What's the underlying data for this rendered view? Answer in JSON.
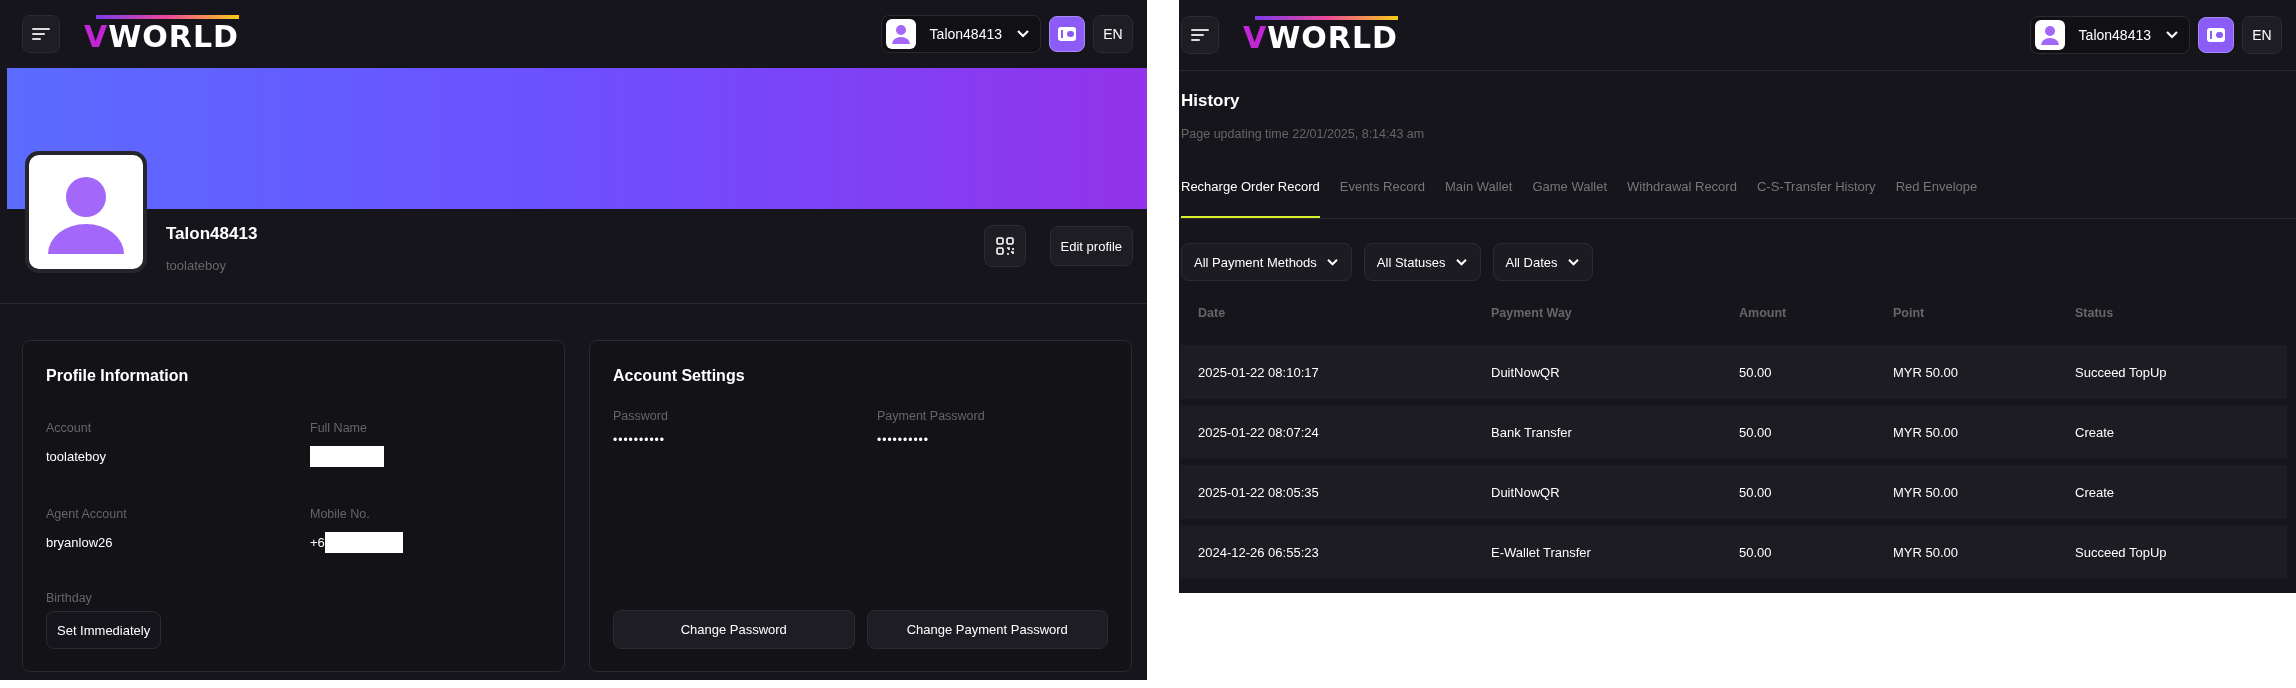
{
  "profile_page": {
    "header": {
      "logo": "VWORLD",
      "user_name": "Talon48413",
      "language": "EN"
    },
    "profile": {
      "name": "Talon48413",
      "username": "toolateboy",
      "edit_button": "Edit profile"
    },
    "profile_information": {
      "title": "Profile Information",
      "fields": [
        {
          "label": "Account",
          "value": "toolateboy",
          "redacted": false
        },
        {
          "label": "Full Name",
          "redacted": true
        },
        {
          "label": "Agent Account",
          "value": "bryanlow26",
          "redacted": false
        },
        {
          "label": "Mobile No.",
          "value": "+6",
          "redacted": true
        }
      ],
      "birthday": {
        "label": "Birthday",
        "button": "Set Immediately"
      }
    },
    "account_settings": {
      "title": "Account Settings",
      "fields": [
        {
          "label": "Password",
          "value": "••••••••••"
        },
        {
          "label": "Payment Password",
          "value": "••••••••••"
        }
      ],
      "buttons": [
        "Change Password",
        "Change Payment Password"
      ]
    }
  },
  "history_page": {
    "header": {
      "logo": "VWORLD",
      "user_name": "Talon48413",
      "language": "EN"
    },
    "title": "History",
    "subtitle": "Page updating time 22/01/2025, 8:14:43 am",
    "tabs": [
      {
        "label": "Recharge Order Record",
        "selected": true
      },
      {
        "label": "Events Record",
        "selected": false
      },
      {
        "label": "Main Wallet",
        "selected": false
      },
      {
        "label": "Game Wallet",
        "selected": false
      },
      {
        "label": "Withdrawal Record",
        "selected": false
      },
      {
        "label": "C-S-Transfer History",
        "selected": false
      },
      {
        "label": "Red Envelope",
        "selected": false
      }
    ],
    "filters": [
      "All Payment Methods",
      "All Statuses",
      "All Dates"
    ],
    "table": {
      "columns": [
        "Date",
        "Payment Way",
        "Amount",
        "Point",
        "Status"
      ],
      "rows": [
        [
          "2025-01-22 08:10:17",
          "DuitNowQR",
          "50.00",
          "MYR 50.00",
          "Succeed TopUp"
        ],
        [
          "2025-01-22 08:07:24",
          "Bank Transfer",
          "50.00",
          "MYR 50.00",
          "Create"
        ],
        [
          "2025-01-22 08:05:35",
          "DuitNowQR",
          "50.00",
          "MYR 50.00",
          "Create"
        ],
        [
          "2024-12-26 06:55:23",
          "E-Wallet Transfer",
          "50.00",
          "MYR 50.00",
          "Succeed TopUp"
        ]
      ]
    }
  }
}
